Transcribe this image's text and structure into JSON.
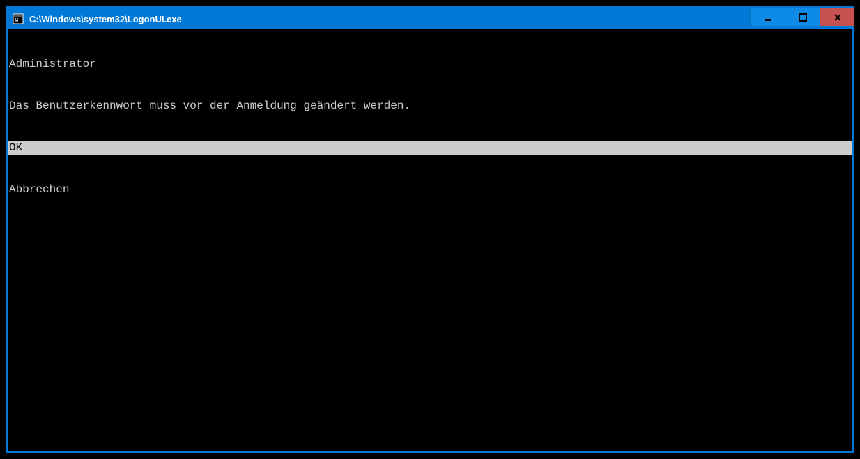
{
  "window": {
    "title": "C:\\Windows\\system32\\LogonUI.exe"
  },
  "content": {
    "user_line": "Administrator",
    "message_line": "Das Benutzerkennwort muss vor der Anmeldung geändert werden.",
    "ok_line": "OK",
    "cancel_line": "Abbrechen"
  }
}
